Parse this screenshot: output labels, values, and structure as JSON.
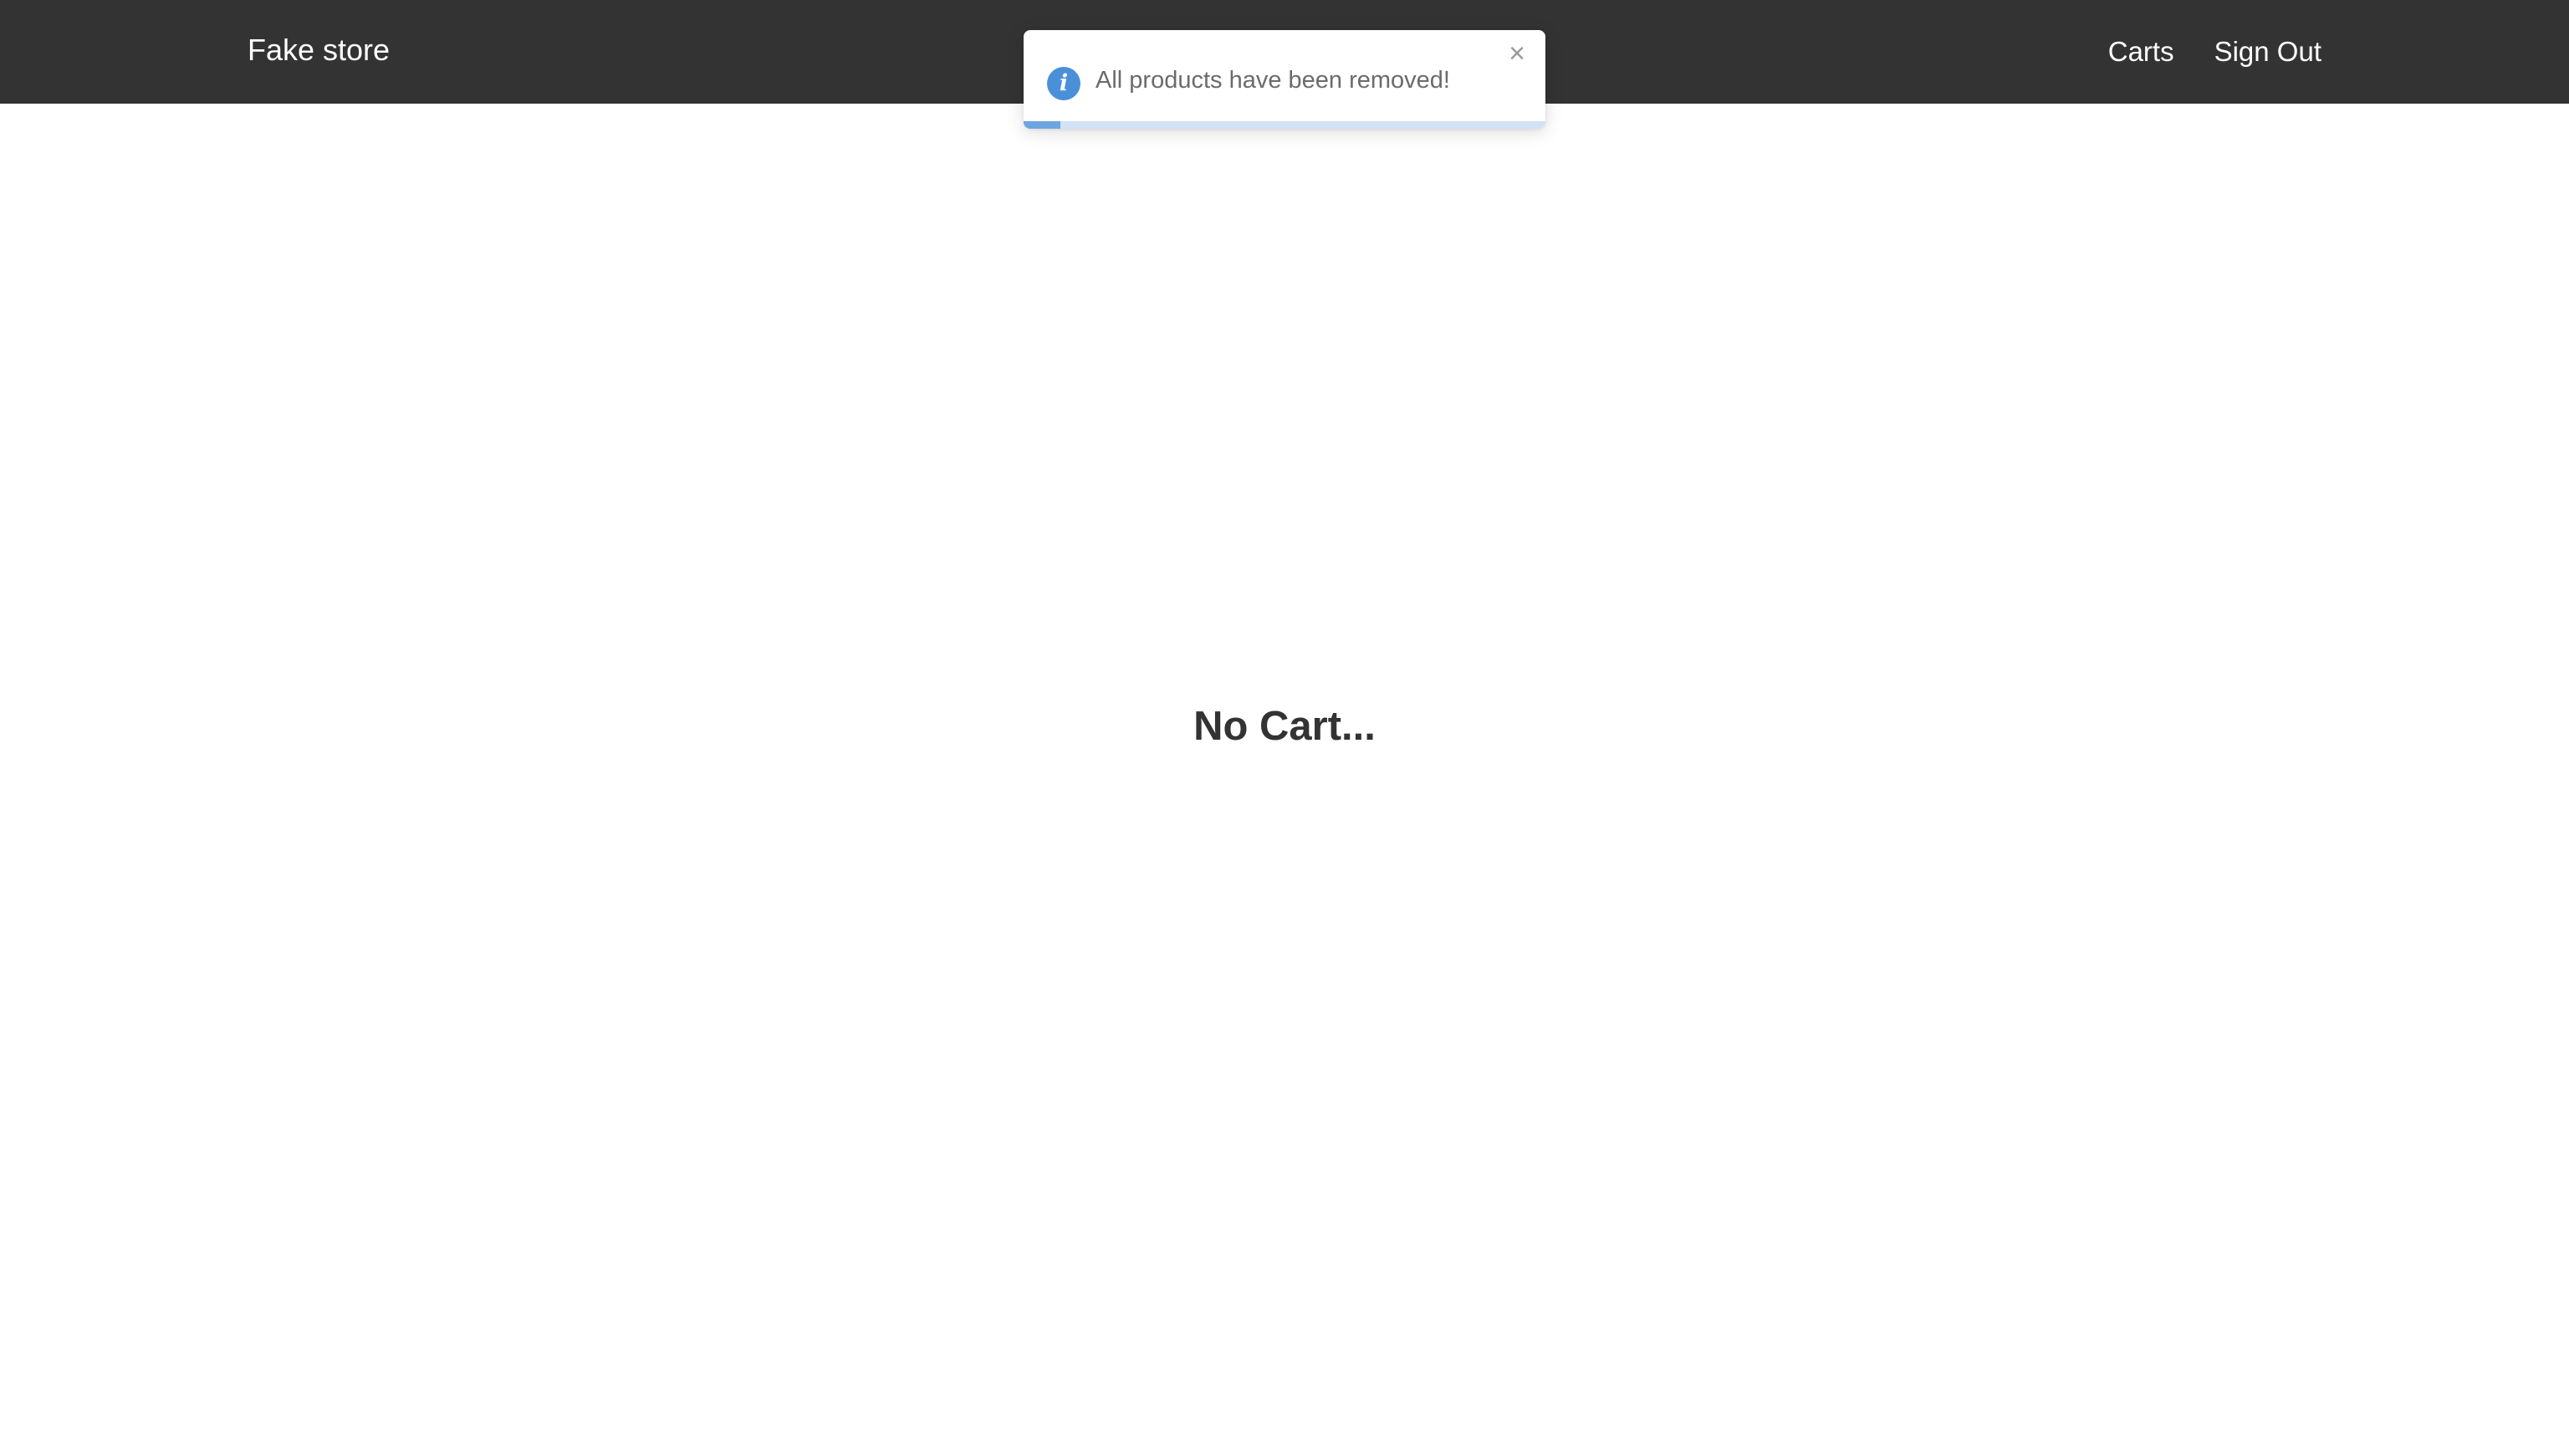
{
  "header": {
    "brand": "Fake store",
    "nav": [
      {
        "label": "Carts"
      },
      {
        "label": "Sign Out"
      }
    ]
  },
  "toast": {
    "icon": "info-icon",
    "icon_glyph": "i",
    "message": "All products have been removed!",
    "close_icon": "close-icon",
    "close_glyph": "×",
    "progress": 0.07,
    "colors": {
      "accent": "#4a90d9"
    }
  },
  "main": {
    "empty_message": "No Cart..."
  },
  "colors": {
    "navbar_bg": "#333333",
    "text_dark": "#333333"
  }
}
